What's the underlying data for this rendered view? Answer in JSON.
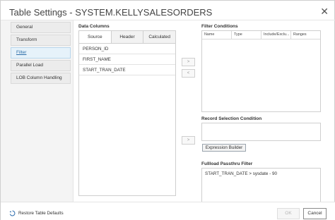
{
  "dialog": {
    "title": "Table Settings - SYSTEM.KELLYSALESORDERS",
    "close_symbol": "✕"
  },
  "nav": {
    "items": [
      {
        "label": "General"
      },
      {
        "label": "Transform"
      },
      {
        "label": "Filter"
      },
      {
        "label": "Parallel Load"
      },
      {
        "label": "LOB Column Handling"
      }
    ],
    "active_index": 2
  },
  "data_columns": {
    "title": "Data Columns",
    "tabs": [
      "Source",
      "Header",
      "Calculated"
    ],
    "active_tab": "Source",
    "items": [
      "PERSON_ID",
      "FIRST_NAME",
      "START_TRAN_DATE"
    ]
  },
  "arrows": {
    "right": ">",
    "left": "<",
    "record_right": ">"
  },
  "filter_conditions": {
    "title": "Filter Conditions",
    "columns": [
      "Name",
      "Type",
      "Include/Exclu...",
      "Ranges"
    ]
  },
  "record_selection": {
    "title": "Record Selection Condition",
    "value": "",
    "expression_builder_label": "Expression Builder"
  },
  "fullload_filter": {
    "title": "Fullload Passthru Filter",
    "value": "START_TRAN_DATE > sysdate - 90"
  },
  "footer": {
    "restore_label": "Restore Table Defaults",
    "ok_label": "OK",
    "cancel_label": "Cancel"
  },
  "colors": {
    "active_nav_bg": "#e6f2fa",
    "active_nav_text": "#2b6da8",
    "border": "#cfcfcf"
  }
}
